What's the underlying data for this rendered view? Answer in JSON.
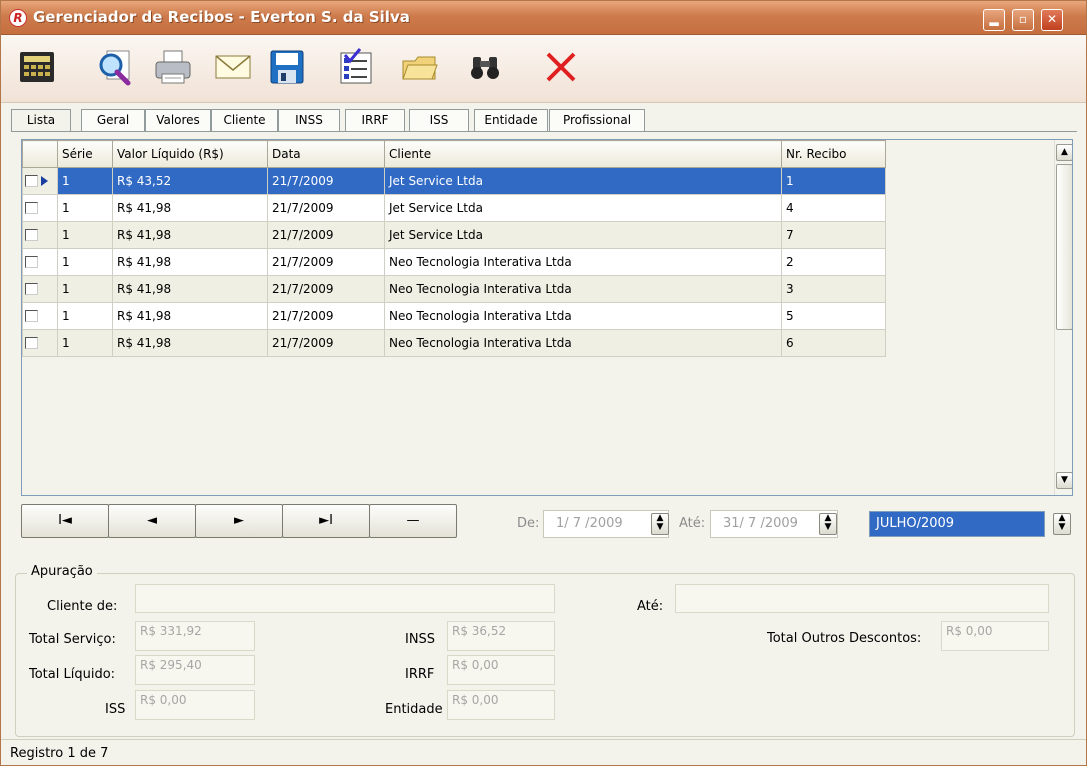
{
  "window": {
    "title": "Gerenciador de Recibos - Everton S. da Silva",
    "logo": "R",
    "controls": {
      "min": "▂",
      "max": "▫",
      "close": "✕"
    }
  },
  "toolbar_icons": [
    "calculator-icon",
    "search-document-icon",
    "printer-icon",
    "envelope-icon",
    "floppy-disk-icon",
    "checklist-icon",
    "folder-icon",
    "binoculars-icon",
    "close-icon"
  ],
  "tabs": [
    "Lista",
    "Geral",
    "Valores",
    "Cliente",
    "INSS",
    "IRRF",
    "ISS",
    "Entidade",
    "Profissional"
  ],
  "grid": {
    "columns": [
      "Série",
      "Valor Líquido (R$)",
      "Data",
      "Cliente",
      "Nr. Recibo"
    ],
    "rows": [
      [
        "1",
        "R$ 43,52",
        "21/7/2009",
        "Jet Service Ltda",
        "1"
      ],
      [
        "1",
        "R$ 41,98",
        "21/7/2009",
        "Jet Service Ltda",
        "4"
      ],
      [
        "1",
        "R$ 41,98",
        "21/7/2009",
        "Jet Service Ltda",
        "7"
      ],
      [
        "1",
        "R$ 41,98",
        "21/7/2009",
        "Neo Tecnologia Interativa Ltda",
        "2"
      ],
      [
        "1",
        "R$ 41,98",
        "21/7/2009",
        "Neo Tecnologia Interativa Ltda",
        "3"
      ],
      [
        "1",
        "R$ 41,98",
        "21/7/2009",
        "Neo Tecnologia Interativa Ltda",
        "5"
      ],
      [
        "1",
        "R$ 41,98",
        "21/7/2009",
        "Neo Tecnologia Interativa Ltda",
        "6"
      ]
    ],
    "selected_row": 0
  },
  "navigator": {
    "first": "I◄",
    "prior": "◄",
    "next": "►",
    "last": "►I",
    "delete": "—"
  },
  "date_range": {
    "from_label": "De:",
    "from_value": "1/ 7 /2009",
    "to_label": "Até:",
    "to_value": "31/ 7 /2009",
    "month": "JULHO/2009"
  },
  "apuracao": {
    "legend": "Apuração",
    "cliente_de_label": "Cliente de:",
    "ate_label": "Até:",
    "total_servico_label": "Total Serviço:",
    "total_servico": "R$ 331,92",
    "total_liquido_label": "Total Líquido:",
    "total_liquido": "R$ 295,40",
    "iss_label": "ISS",
    "iss": "R$ 0,00",
    "inss_label": "INSS",
    "inss": "R$ 36,52",
    "irrf_label": "IRRF",
    "irrf": "R$ 0,00",
    "entidade_label": "Entidade",
    "entidade": "R$ 0,00",
    "outros_label": "Total Outros Descontos:",
    "outros": "R$ 0,00"
  },
  "status": "Registro 1 de 7"
}
